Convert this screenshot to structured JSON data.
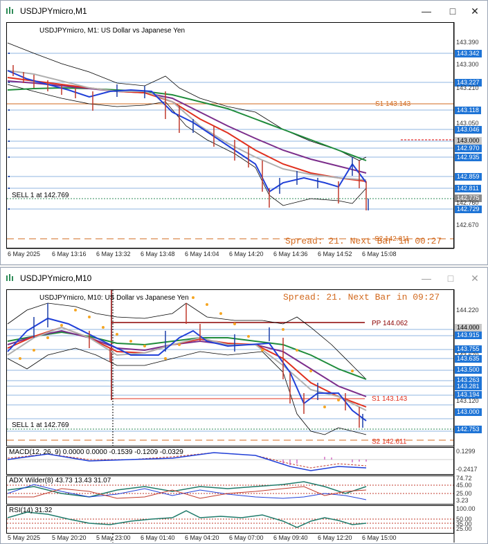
{
  "colors": {
    "candle": "#c0392b",
    "bull": "#1a3ea8",
    "tag": "#1e74d6",
    "s1": "#d2691e",
    "pp": "#8b0000",
    "ma_green": "#1e8b3a",
    "ma_purple": "#7b2d8b",
    "ma_red": "#e0301e",
    "ma_blue": "#1f3fd8",
    "ma_gray": "#b0b0b0",
    "psar": "#f5a623"
  },
  "window1": {
    "title": "USDJPYmicro,M1",
    "icons": [
      "app-icon",
      "minimize-icon",
      "maximize-icon",
      "close-icon"
    ],
    "chart_label": "USDJPYmicro, M1:  US Dollar vs Japanese Yen",
    "sell_label": "SELL 1 at 142.769",
    "s1_label": "S1 143.143",
    "spread": "Spread: 21. Next Bar in 00:27",
    "s2_overlap": "S2 142.611",
    "price_axis": [
      "143.390",
      "143.342",
      "143.300",
      "143.227",
      "143.210",
      "143.118",
      "143.050",
      "143.046",
      "143.000",
      "142.970",
      "142.935",
      "142.859",
      "142.811",
      "142.775",
      "142.760",
      "142.729",
      "142.670"
    ],
    "time_axis": [
      "6 May 2025",
      "6 May 13:16",
      "6 May 13:32",
      "6 May 13:48",
      "6 May 14:04",
      "6 May 14:20",
      "6 May 14:36",
      "6 May 14:52",
      "6 May 15:08"
    ]
  },
  "window2": {
    "title": "USDJPYmicro,M10",
    "icons": [
      "app-icon",
      "minimize-icon",
      "maximize-icon",
      "close-icon"
    ],
    "chart_label": "USDJPYmicro, M10:  US Dollar vs Japanese Yen",
    "spread": "Spread: 21. Next Bar in 09:27",
    "pp_label": "PP 144.062",
    "s1_label": "S1 143.143",
    "s2_label": "S2 142.611",
    "sell_label": "SELL 1 at 142.769",
    "price_axis": [
      "144.220",
      "144.000",
      "143.915",
      "143.755",
      "143.670",
      "143.635",
      "143.500",
      "143.263",
      "143.281",
      "143.194",
      "143.120",
      "143.000",
      "142.753"
    ],
    "macd_label": "MACD(12, 26, 9) 0.0000 0.0000 -0.1539 -0.1209 -0.0329",
    "macd_axis": [
      "0.1299",
      "-0.2417"
    ],
    "adx_label": "ADX Wilder(8) 43.73 13.43 31.07",
    "adx_axis": [
      "74.72",
      "45.00",
      "25.00",
      "3.23"
    ],
    "rsi_label": "RSI(14) 31.32",
    "rsi_axis": [
      "100.00",
      "50.00",
      "35.00",
      "25.00"
    ],
    "time_axis": [
      "5 May 2025",
      "5 May 20:20",
      "5 May 23:00",
      "6 May 01:40",
      "6 May 04:20",
      "6 May 07:00",
      "6 May 09:40",
      "6 May 12:20",
      "6 May 15:00"
    ]
  }
}
